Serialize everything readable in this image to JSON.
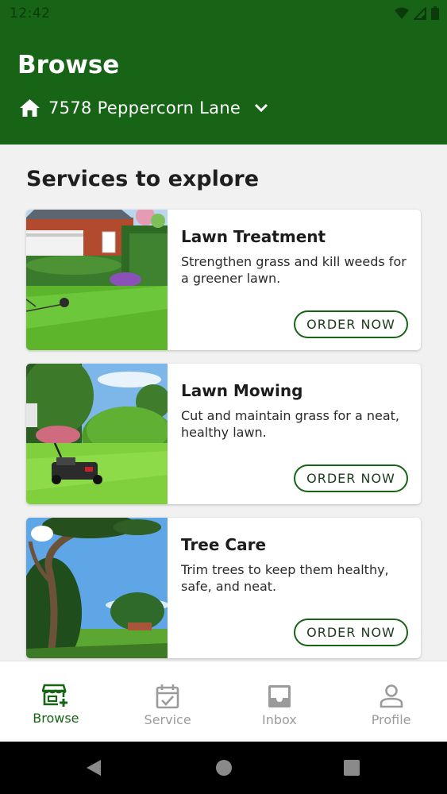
{
  "status_bar": {
    "time": "12:42"
  },
  "header": {
    "title": "Browse",
    "address": "7578 Peppercorn Lane",
    "home_icon": "home-icon",
    "dropdown_icon": "chevron-down-icon"
  },
  "main": {
    "section_title": "Services to explore",
    "services": [
      {
        "title": "Lawn Treatment",
        "description": "Strengthen grass and kill weeds for a greener lawn.",
        "button": "ORDER NOW"
      },
      {
        "title": "Lawn Mowing",
        "description": "Cut and maintain grass for a neat, healthy lawn.",
        "button": "ORDER NOW"
      },
      {
        "title": "Tree Care",
        "description": "Trim trees to keep them healthy, safe, and neat.",
        "button": "ORDER NOW"
      }
    ]
  },
  "bottom_nav": {
    "items": [
      {
        "label": "Browse",
        "icon": "browse-store-icon",
        "active": true
      },
      {
        "label": "Service",
        "icon": "calendar-check-icon",
        "active": false
      },
      {
        "label": "Inbox",
        "icon": "inbox-icon",
        "active": false
      },
      {
        "label": "Profile",
        "icon": "person-icon",
        "active": false
      }
    ]
  },
  "colors": {
    "brand_green": "#176416",
    "inactive_gray": "#9b9b9b",
    "background": "#f1f1f1"
  }
}
